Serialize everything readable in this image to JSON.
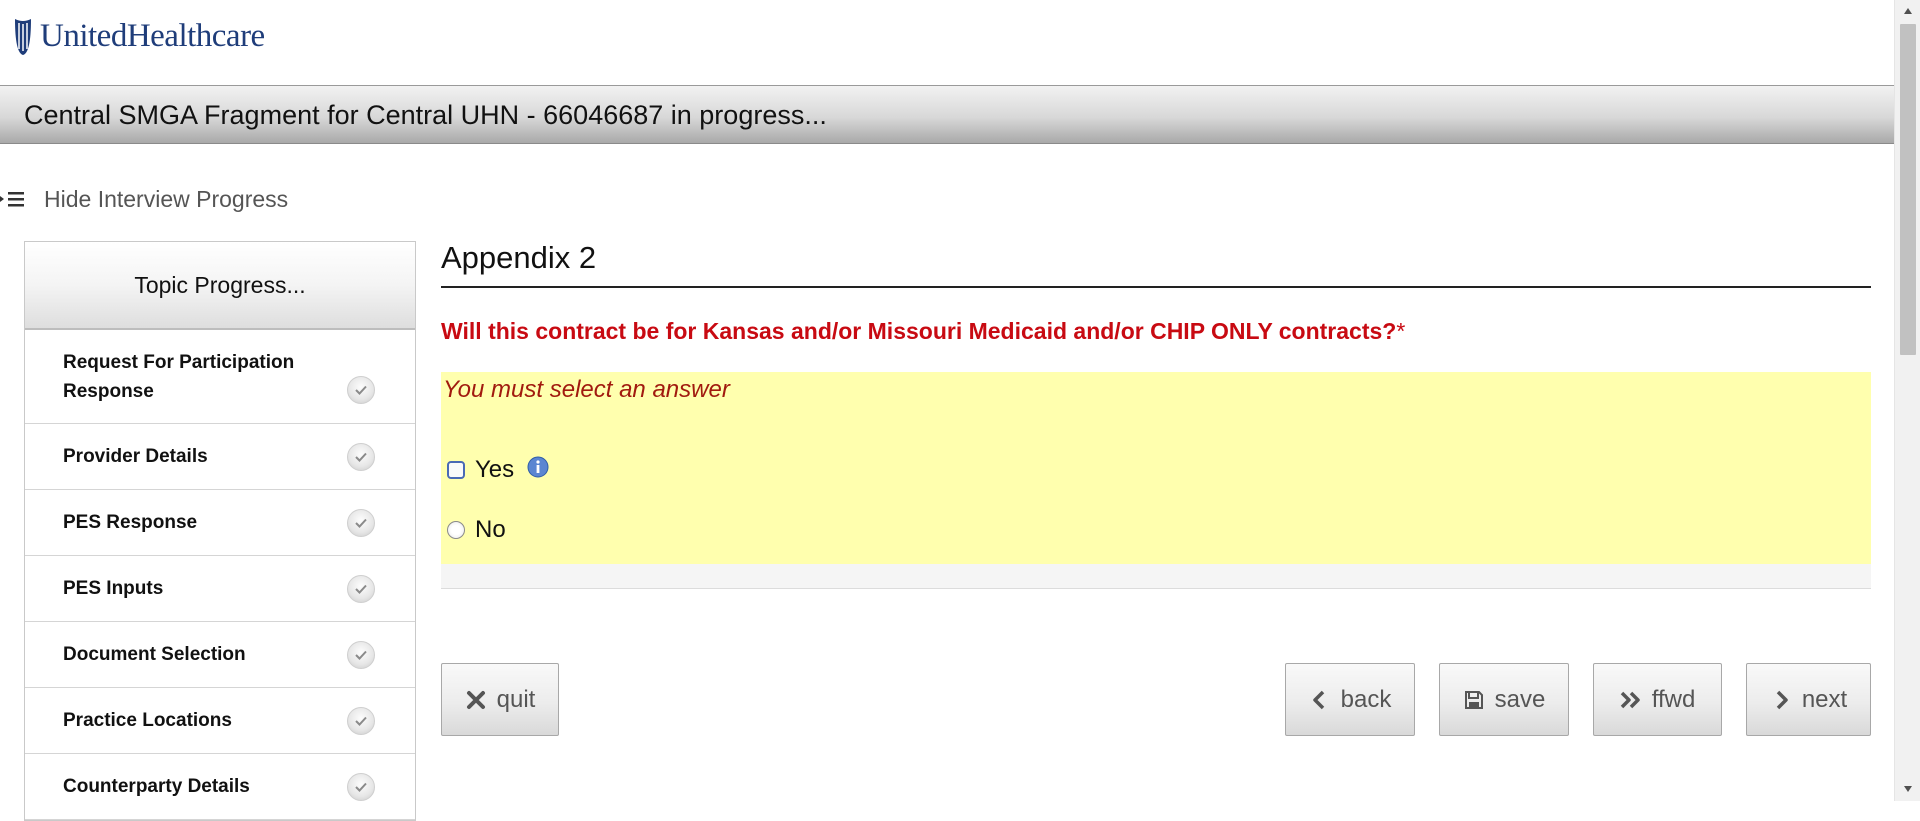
{
  "brand": {
    "name": "UnitedHealthcare",
    "logo_icon": "uhc-shield-icon",
    "color": "#1f3d7a"
  },
  "titlebar": {
    "title": "Central SMGA Fragment for Central UHN - 66046687 in progress..."
  },
  "progress_toggle": {
    "label": "Hide Interview Progress",
    "icon": "collapse-list-icon"
  },
  "sidebar": {
    "header": "Topic Progress...",
    "items": [
      {
        "label": "Request For Participation Response",
        "status": "complete"
      },
      {
        "label": "Provider Details",
        "status": "complete"
      },
      {
        "label": "PES Response",
        "status": "complete"
      },
      {
        "label": "PES Inputs",
        "status": "complete"
      },
      {
        "label": "Document Selection",
        "status": "complete"
      },
      {
        "label": "Practice Locations",
        "status": "complete"
      },
      {
        "label": "Counterparty Details",
        "status": "complete"
      }
    ]
  },
  "main": {
    "heading": "Appendix 2",
    "question": "Will this contract be for Kansas and/or Missouri Medicaid and/or CHIP ONLY contracts?",
    "required_marker": "*",
    "error_message": "You must select an answer",
    "options": [
      {
        "label": "Yes",
        "control": "checkbox",
        "checked": false,
        "has_info": true
      },
      {
        "label": "No",
        "control": "radio",
        "checked": false
      }
    ],
    "colors": {
      "question": "#c80a12",
      "error_bg": "#ffffae",
      "error_text": "#a11a0f"
    }
  },
  "buttons": {
    "quit": "quit",
    "back": "back",
    "save": "save",
    "ffwd": "ffwd",
    "next": "next"
  }
}
